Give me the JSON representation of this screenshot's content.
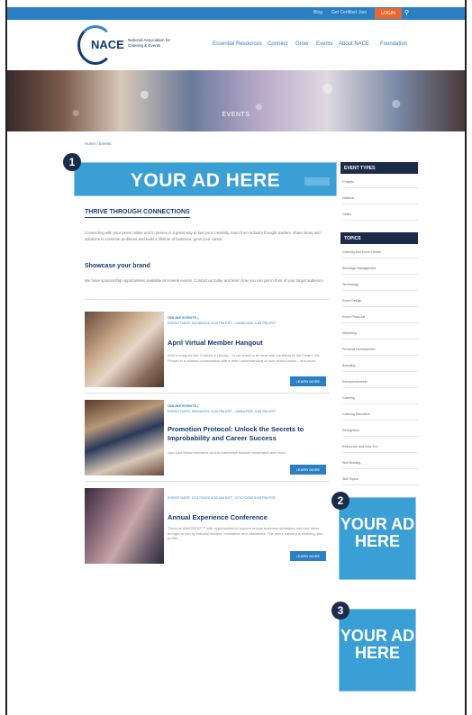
{
  "topbar": {
    "links": [
      "Blog",
      "Get Certified",
      "Join"
    ],
    "login_label": "LOGIN",
    "search_icon": "search-icon"
  },
  "header": {
    "logo": "NACE",
    "logo_sub": "National Association for Catering & Events",
    "nav": [
      "Essential Resources",
      "Connect",
      "Grow",
      "Events",
      "About NACE",
      "Foundation"
    ]
  },
  "hero": {
    "title": "EVENTS"
  },
  "breadcrumb": "Home / Events",
  "ads": {
    "ad1_text": "YOUR AD HERE",
    "ad2_text": "YOUR AD HERE",
    "ad3_text": "YOUR AD HERE"
  },
  "badges": [
    "1",
    "2",
    "3"
  ],
  "main": {
    "section_title": "THRIVE THROUGH CONNECTIONS",
    "section_text": "Connecting with your peers online and in person is a great way to fuel your creativity, learn from industry thought leaders, share ideas and solutions to common problems and build a lifetime of business, grow your career.",
    "sub_title": "Showcase your brand",
    "sub_text": "We have sponsorship opportunities available at several events. Contact us today and learn how you can get in front of your target audience."
  },
  "events": [
    {
      "category": "ONLINE EVENTS |",
      "date": "EVENT DATE: 04/28/2022 3:00 PM EST - 04/28/2022 4:00 PM EST",
      "title": "April Virtual Member Hangout",
      "desc": "Who's ready for the Chicken & Hiccup... in our world to be kept with the fellow in the Fresh? Oh. People in a relaxed conversation with a team understanding of how others tackle... and more.",
      "learn": "LEARN MORE"
    },
    {
      "category": "ONLINE EVENTS |",
      "date": "EVENT DATE: 05/04/2022 3:00 PM EST - 05/04/2022 4:00 PM EST",
      "title": "Promotion Protocol: Unlock the Secrets to Improbability and Career Success",
      "desc": "Join your fellow members for this interactive session moderated and more.",
      "learn": "LEARN MORE"
    },
    {
      "category": "",
      "date": "EVENT DATE: 07/17/2022 8:00 AM EST - 07/17/2022 5:00 PM EST",
      "title": "Annual Experience Conference",
      "desc": "Thrive at #NACEEXP™ with opportunities to explore unique business strategies and new ideas brought to you by industry leaders, innovators and visionaries. The event industry is evolving, and profits...",
      "learn": "LEARN MORE"
    }
  ],
  "sidebar": {
    "event_types_label": "EVENT TYPES",
    "event_types": [
      "Chapter",
      "National",
      "Online"
    ],
    "topics_label": "TOPICS",
    "topics": [
      "Catering and Event Trends",
      "Beverage Management",
      "Technology",
      "Event Design",
      "Event Photo Art",
      "Marketing",
      "Personal Development",
      "Branding",
      "Entrepreneurship",
      "Catering",
      "Catering Education",
      "Recognition",
      "Resources and How To's",
      "Skill Building",
      "Skill Topics"
    ]
  }
}
